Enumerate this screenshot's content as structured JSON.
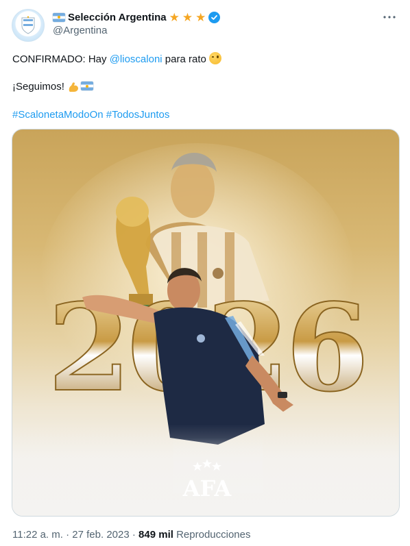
{
  "account": {
    "display_name": "Selección Argentina",
    "handle": "@Argentina",
    "badges": [
      "argentina-flag",
      "star",
      "star",
      "star",
      "verified-badge"
    ]
  },
  "tweet": {
    "line1_prefix": "CONFIRMADO: Hay ",
    "line1_mention": "@lioscaloni",
    "line1_suffix": " para rato ",
    "line2_text": "¡Seguimos! ",
    "hashtag1": "#ScalonetaModoOn",
    "hashtag2": "#TodosJuntos"
  },
  "media": {
    "year_text": "2026",
    "logo_text": "AFA",
    "colors": {
      "gold": "#c9a45a",
      "navy": "#1e2a44",
      "stripe_blue": "#74acdf"
    }
  },
  "meta": {
    "time": "11:22 a. m.",
    "separator": " · ",
    "date": "27 feb. 2023",
    "views_count": "849 mil",
    "views_label": "Reproducciones"
  },
  "icons": {
    "more": "more-options-icon",
    "verified": "verified-icon"
  },
  "colors": {
    "link": "#1d9bf0",
    "secondary_text": "#536471",
    "star": "#f5a623"
  }
}
